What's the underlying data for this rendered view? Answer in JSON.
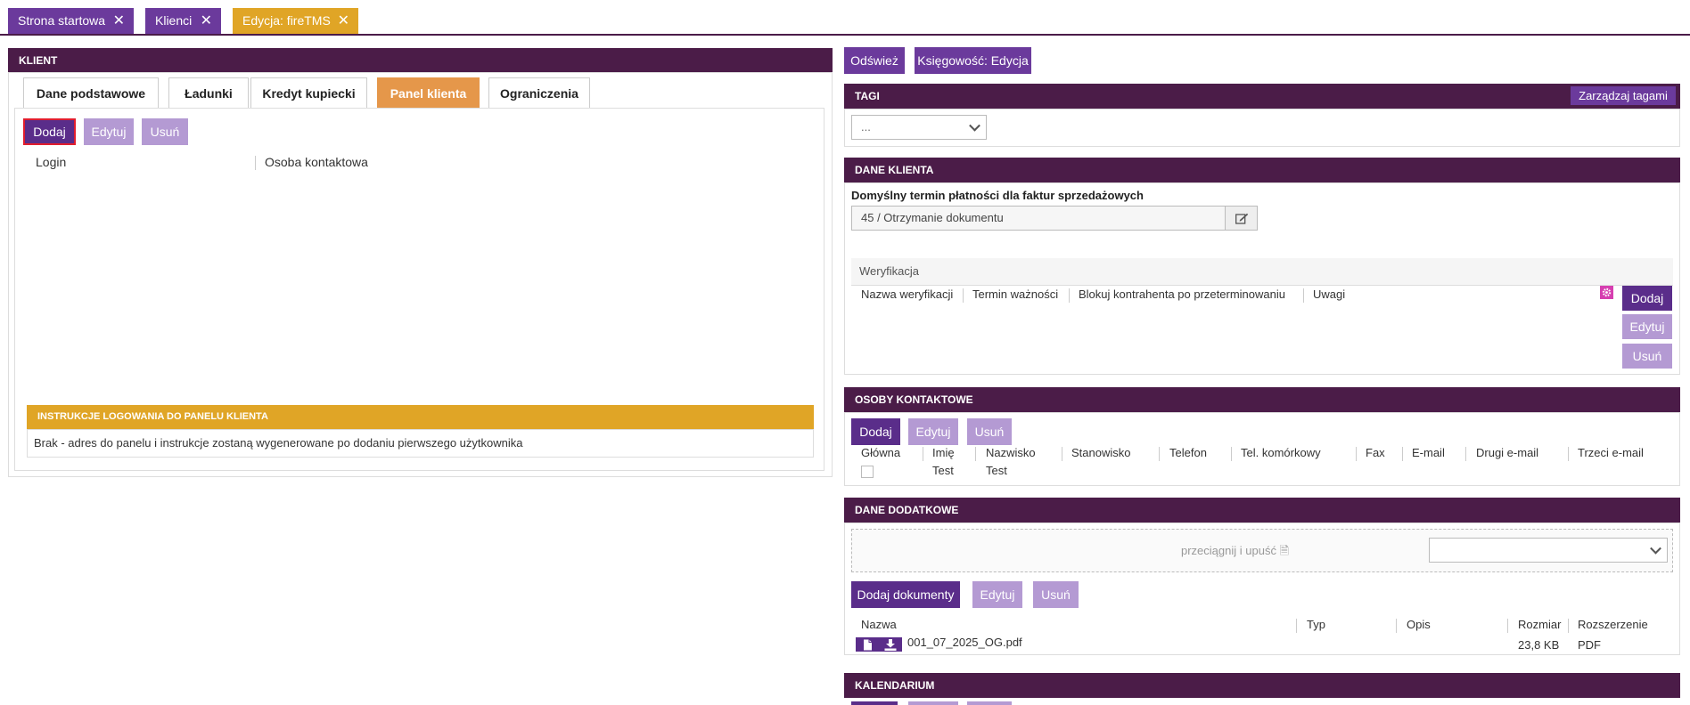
{
  "tabs": [
    {
      "label": "Strona startowa"
    },
    {
      "label": "Klienci"
    },
    {
      "label": "Edycja: fireTMS"
    }
  ],
  "left": {
    "header": "KLIENT",
    "tabs": [
      "Dane podstawowe",
      "Ładunki",
      "Kredyt kupiecki",
      "Panel klienta",
      "Ograniczenia"
    ],
    "active_tab": "Panel klienta",
    "buttons": {
      "add": "Dodaj",
      "edit": "Edytuj",
      "delete": "Usuń"
    },
    "columns": [
      "Login",
      "Osoba kontaktowa"
    ],
    "instructions": {
      "header": "INSTRUKCJE LOGOWANIA DO PANELU KLIENTA",
      "text": "Brak - adres do panelu i instrukcje zostaną wygenerowane po dodaniu pierwszego użytkownika"
    }
  },
  "right": {
    "top_buttons": {
      "refresh": "Odśwież",
      "accounting": "Księgowość: Edycja"
    },
    "tags": {
      "header": "TAGI",
      "manage": "Zarządzaj tagami",
      "select_value": "..."
    },
    "client_data": {
      "header": "DANE KLIENTA",
      "payment_label": "Domyślny termin płatności dla faktur sprzedażowych",
      "payment_value": "45 / Otrzymanie dokumentu",
      "verification_title": "Weryfikacja",
      "verification_columns": [
        "Nazwa weryfikacji",
        "Termin ważności",
        "Blokuj kontrahenta po przeterminowaniu",
        "Uwagi"
      ],
      "buttons": {
        "add": "Dodaj",
        "edit": "Edytuj",
        "delete": "Usuń"
      }
    },
    "contacts": {
      "header": "OSOBY KONTAKTOWE",
      "buttons": {
        "add": "Dodaj",
        "edit": "Edytuj",
        "delete": "Usuń"
      },
      "columns": [
        "Główna",
        "Imię",
        "Nazwisko",
        "Stanowisko",
        "Telefon",
        "Tel. komórkowy",
        "Fax",
        "E-mail",
        "Drugi e-mail",
        "Trzeci e-mail"
      ],
      "rows": [
        {
          "main": false,
          "first_name": "Test",
          "last_name": "Test"
        }
      ]
    },
    "additional": {
      "header": "DANE DODATKOWE",
      "dropzone": "przeciągnij i upuść",
      "buttons": {
        "add_docs": "Dodaj dokumenty",
        "edit": "Edytuj",
        "delete": "Usuń"
      },
      "columns": [
        "Nazwa",
        "Typ",
        "Opis",
        "Rozmiar",
        "Rozszerzenie"
      ],
      "files": [
        {
          "name": "001_07_2025_OG.pdf",
          "type": "",
          "description": "",
          "size": "23,8 KB",
          "extension": "PDF"
        }
      ]
    },
    "calendar": {
      "header": "KALENDARIUM"
    }
  },
  "colors": {
    "purple": "#6b3a9c",
    "dark_header": "#4b1c48",
    "gold": "#e0a526",
    "orange_tab": "#e5974a",
    "light_purple": "#b49ad3"
  }
}
